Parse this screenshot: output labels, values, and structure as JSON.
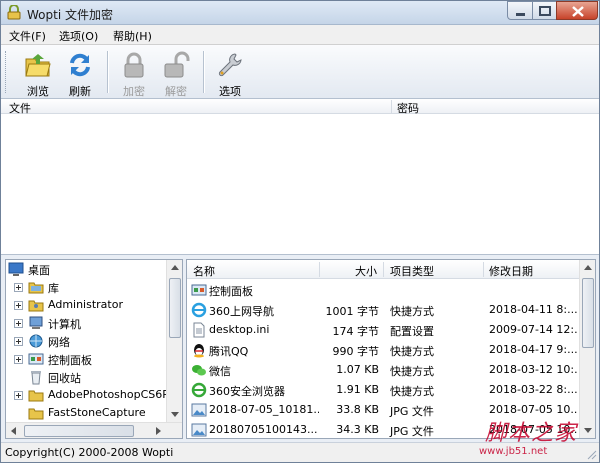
{
  "window": {
    "title": "Wopti 文件加密"
  },
  "menu": [
    "文件(F)",
    "选项(O)",
    "帮助(H)"
  ],
  "toolbar": {
    "browse": "浏览",
    "refresh": "刷新",
    "encrypt": "加密",
    "decrypt": "解密",
    "options": "选项"
  },
  "top_list": {
    "col_file": "文件",
    "col_password": "密码"
  },
  "tree": {
    "root": "桌面",
    "items": [
      "库",
      "Administrator",
      "计算机",
      "网络",
      "控制面板",
      "回收站",
      "AdobePhotoshopCS6P",
      "FastStoneCapture"
    ]
  },
  "detail": {
    "headers": {
      "name": "名称",
      "size": "大小",
      "type": "项目类型",
      "date": "修改日期"
    },
    "rows": [
      {
        "name": "控制面板",
        "size": "",
        "type": "",
        "date": "",
        "icon": "control-panel"
      },
      {
        "name": "360上网导航",
        "size": "1001 字节",
        "type": "快捷方式",
        "date": "2018-04-11 8:...",
        "icon": "ie"
      },
      {
        "name": "desktop.ini",
        "size": "174 字节",
        "type": "配置设置",
        "date": "2009-07-14 12:...",
        "icon": "ini"
      },
      {
        "name": "腾讯QQ",
        "size": "990 字节",
        "type": "快捷方式",
        "date": "2018-04-17 9:...",
        "icon": "qq"
      },
      {
        "name": "微信",
        "size": "1.07 KB",
        "type": "快捷方式",
        "date": "2018-03-12 10:...",
        "icon": "wechat"
      },
      {
        "name": "360安全浏览器",
        "size": "1.91 KB",
        "type": "快捷方式",
        "date": "2018-03-22 8:...",
        "icon": "ie"
      },
      {
        "name": "2018-07-05_10181...",
        "size": "33.8 KB",
        "type": "JPG 文件",
        "date": "2018-07-05 10...",
        "icon": "jpg"
      },
      {
        "name": "20180705100143...",
        "size": "34.3 KB",
        "type": "JPG 文件",
        "date": "2018-07-05 10...",
        "icon": "jpg"
      }
    ]
  },
  "status": {
    "text": "Copyright(C) 2000-2008 Wopti"
  },
  "watermark": {
    "text": "脚本之家",
    "url": "www.jb51.net"
  }
}
